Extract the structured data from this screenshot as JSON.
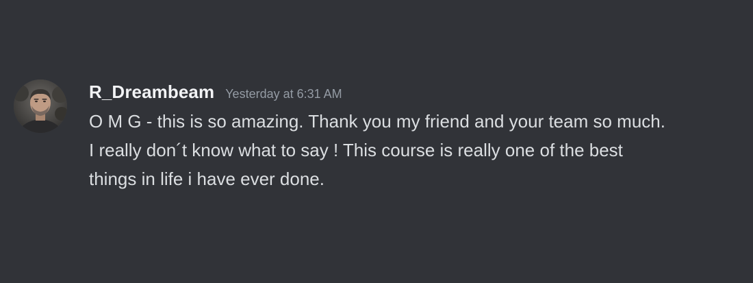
{
  "message": {
    "username": "R_Dreambeam",
    "timestamp": "Yesterday at 6:31 AM",
    "lines": [
      "O M G - this is so amazing. Thank you my friend and your team so much.",
      "I really don´t know what to say ! This course is really one of the best",
      "things in life i have ever done."
    ]
  },
  "colors": {
    "background": "#313338",
    "username": "#f2f3f5",
    "timestamp": "#949ba4",
    "text": "#dbdee1"
  },
  "icons": {
    "avatar": "user-avatar-photo"
  }
}
